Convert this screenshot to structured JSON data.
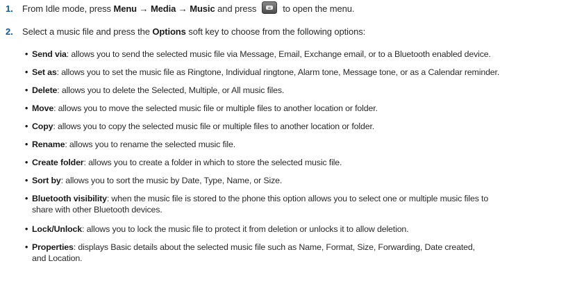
{
  "steps": [
    {
      "number": "1.",
      "pre": "From Idle mode, press ",
      "menu": "Menu",
      "arrow1": " → ",
      "media": "Media",
      "arrow2": " → ",
      "music": "Music",
      "mid": " and press",
      "post": "to open the menu.",
      "key_icon": "ok-key-icon"
    },
    {
      "number": "2.",
      "pre": "Select a music file and press the ",
      "bold": "Options",
      "post": " soft key to choose from the following options:"
    }
  ],
  "options": [
    {
      "term": "Send via",
      "desc": ": allows you to send the selected music file via Message, Email, Exchange email, or to a Bluetooth enabled device."
    },
    {
      "term": "Set as",
      "desc": ": allows you to set the music file as Ringtone, Individual ringtone, Alarm tone, Message tone, or as a Calendar reminder."
    },
    {
      "term": "Delete",
      "desc": ": allows you to delete the Selected, Multiple, or All music files."
    },
    {
      "term": "Move",
      "desc": ": allows you to move the selected music file or multiple files to another location or folder."
    },
    {
      "term": "Copy",
      "desc": ": allows you to copy the selected music file or multiple files to another location or folder."
    },
    {
      "term": "Rename",
      "desc": ": allows you to rename the selected music file."
    },
    {
      "term": "Create folder",
      "desc": ": allows you to create a folder in which to store the selected music file."
    },
    {
      "term": "Sort by",
      "desc": ": allows you to sort the music by Date, Type, Name, or Size."
    },
    {
      "term": "Bluetooth visibility",
      "desc": ": when the music file is stored to the phone this option allows you to select one or multiple music files to",
      "cont": "share with other Bluetooth devices."
    },
    {
      "term": "Lock/Unlock",
      "desc": ": allows you to lock the music file to protect it from deletion or unlocks it to allow deletion."
    },
    {
      "term": "Properties",
      "desc": ": displays Basic details about the selected music file such as Name, Format, Size, Forwarding, Date created,",
      "cont": "and Location."
    }
  ],
  "bullet_char": "•"
}
